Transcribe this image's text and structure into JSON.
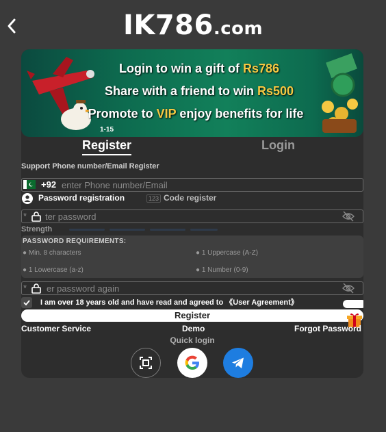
{
  "header": {
    "logo_main": "IK786",
    "logo_suffix": ".com"
  },
  "banner": {
    "line1_prefix": "Login to win a gift of ",
    "line1_amount": "Rs786",
    "line2_prefix": "Share with a friend to win ",
    "line2_amount": "Rs500",
    "line3_prefix": "Promote to ",
    "line3_highlight": "VIP",
    "line3_suffix": " enjoy benefits for life",
    "page_indicator": "1-15"
  },
  "tabs": {
    "register": "Register",
    "login": "Login"
  },
  "form": {
    "support_label": "Support Phone number/Email Register",
    "country_code": "+92",
    "phone_placeholder": "enter Phone number/Email",
    "password_registration": "Password registration",
    "code_badge": "123",
    "code_register": "Code register",
    "password_placeholder": "ter password",
    "password_prefix": "*",
    "strength_label": "Strength",
    "requirements_title": "PASSWORD REQUIREMENTS:",
    "req_min": "Min. 8 characters",
    "req_upper": "1 Uppercase (A-Z)",
    "req_lower": "1 Lowercase (a-z)",
    "req_number": "1 Number (0-9)",
    "password_again_placeholder": "er password again",
    "password_again_prefix": "*",
    "agreement_text": "I am over 18 years old and have read and agreed to 《User Agreement》",
    "register_button": "Register"
  },
  "footer": {
    "customer_service": "Customer Service",
    "demo": "Demo",
    "forgot_password": "Forgot Password",
    "quick_login": "Quick login"
  },
  "colors": {
    "background": "#3a3a3a",
    "card": "#2d2d2d",
    "banner_green": "#0d6b4f",
    "gold": "#f5c842",
    "telegram": "#1e7de0"
  }
}
